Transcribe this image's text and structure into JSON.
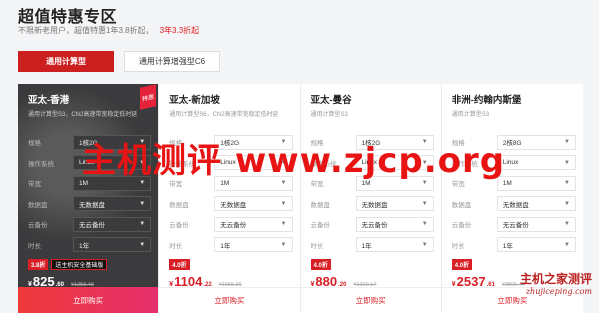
{
  "header": {
    "title": "超值特惠专区",
    "subtitle": "不限新老用户，超值特惠1年3.8折起，",
    "subtitle_highlight": "3年3.3折起"
  },
  "tabs": [
    {
      "label": "通用计算型",
      "active": true
    },
    {
      "label": "通用计算增强型C6",
      "active": false
    }
  ],
  "spec_labels": {
    "spec": "规格",
    "os": "操作系统",
    "bandwidth": "带宽",
    "disk": "数据盘",
    "backup": "云备份",
    "duration": "时长"
  },
  "cards": [
    {
      "title": "亚太-香港",
      "desc": "通用计算型S3，CN2高速带宽稳定低时延",
      "hot_badge": "特惠",
      "spec": "1核2G",
      "os": "Linux",
      "bandwidth": "1M",
      "disk": "无数据盘",
      "backup": "无云备份",
      "duration": "1年",
      "discount": "3.8折",
      "promo": "送主机安全基础版",
      "currency": "¥",
      "price": "825",
      "price_decimal": ".60",
      "original_price": "¥1356.46",
      "buy_label": "立即购买"
    },
    {
      "title": "亚太-新加坡",
      "desc": "通用计算型S6，CN2高速带宽稳定低时延",
      "spec": "1核2G",
      "os": "Linux",
      "bandwidth": "1M",
      "disk": "无数据盘",
      "backup": "无云备份",
      "duration": "1年",
      "discount": "4.0折",
      "currency": "¥",
      "price": "1104",
      "price_decimal": ".22",
      "original_price": "¥1655.36",
      "buy_label": "立即购买"
    },
    {
      "title": "亚太-曼谷",
      "desc": "通用计算型S3",
      "spec": "1核2G",
      "os": "Linux",
      "bandwidth": "1M",
      "disk": "无数据盘",
      "backup": "无云备份",
      "duration": "1年",
      "discount": "4.0折",
      "currency": "¥",
      "price": "880",
      "price_decimal": ".20",
      "original_price": "¥1320.17",
      "buy_label": "立即购买"
    },
    {
      "title": "非洲-约翰内斯堡",
      "desc": "通用计算型S3",
      "spec": "2核8G",
      "os": "Linux",
      "bandwidth": "1M",
      "disk": "无数据盘",
      "backup": "无云备份",
      "duration": "1年",
      "discount": "4.0折",
      "currency": "¥",
      "price": "2537",
      "price_decimal": ".61",
      "original_price": "¥3806.47",
      "buy_label": "立即购买"
    }
  ],
  "watermark": {
    "main_text": "主机测评 www.zjcp.org",
    "corner_cn": "主机之家测评",
    "corner_en": "zhujiceping.com"
  },
  "colors": {
    "accent_red": "#cc1f1f",
    "featured_bg": "#3b3b3d",
    "price_red": "#d81f26"
  }
}
